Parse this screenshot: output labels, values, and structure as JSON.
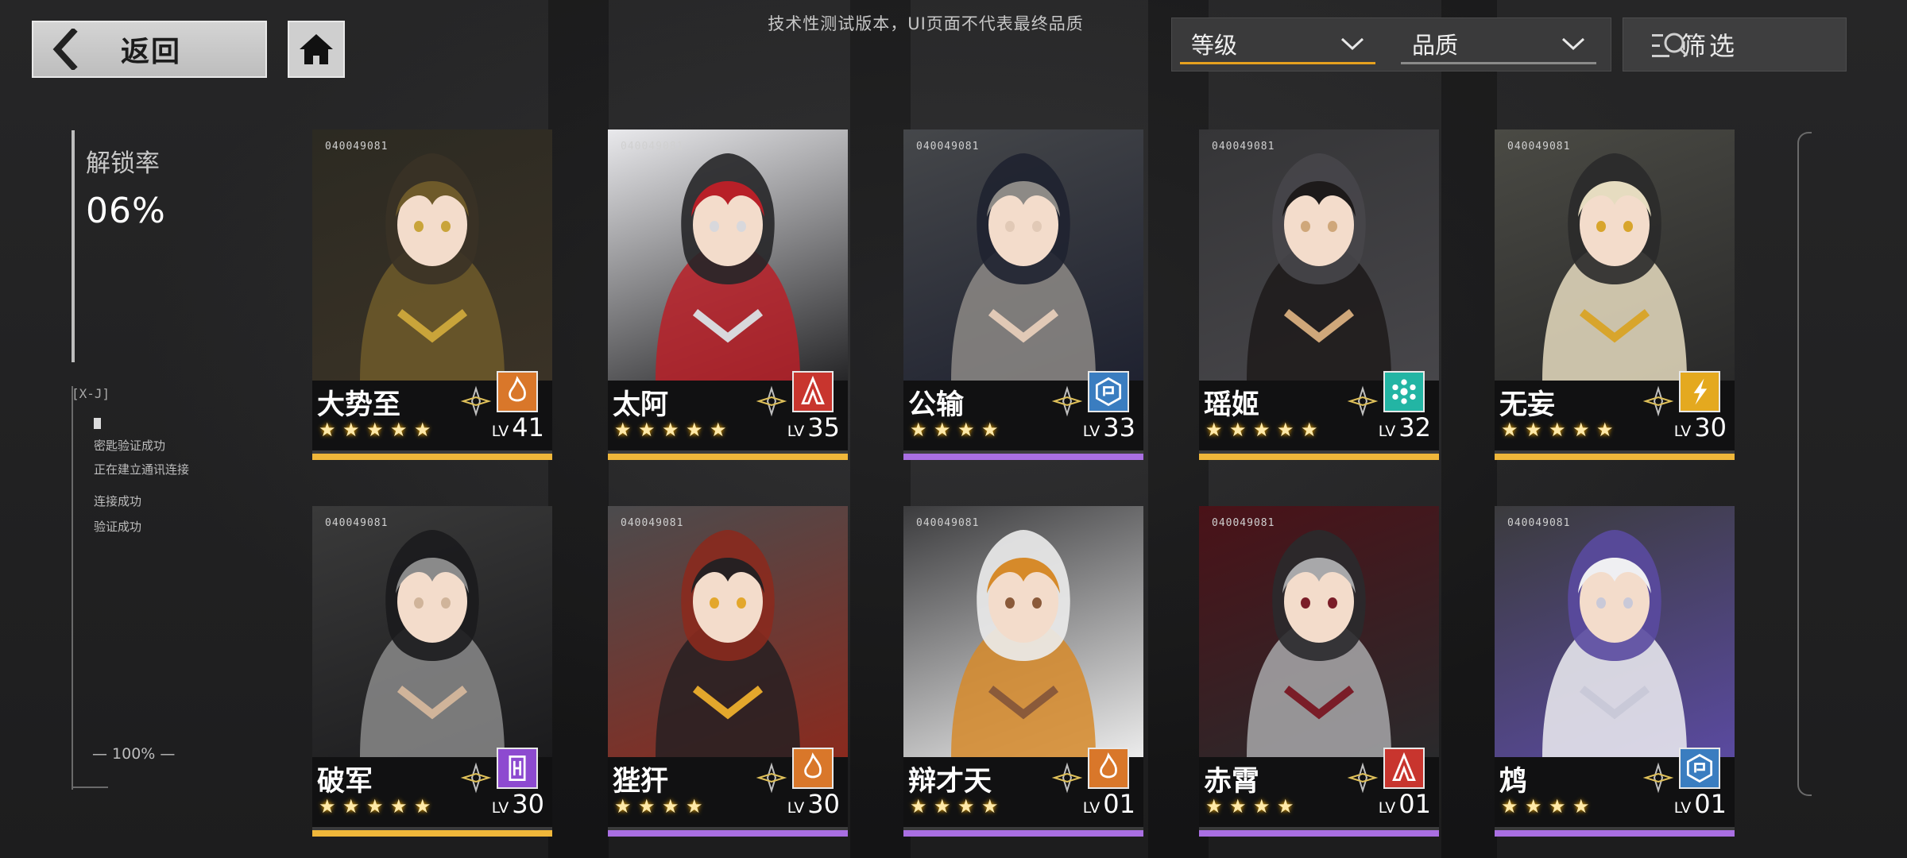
{
  "nav": {
    "back_label": "返回"
  },
  "notice": "技术性测试版本，UI页面不代表最终品质",
  "sort": {
    "primary": "等级",
    "secondary": "品质",
    "filter_label": "筛选"
  },
  "side_panel": {
    "unlock_label": "解锁率",
    "unlock_value": "06%",
    "terminal_tag": "[X-J]",
    "log_lines": [
      "密匙验证成功",
      "正在建立通讯连接",
      "连接成功",
      "验证成功"
    ],
    "progress_label": "100%"
  },
  "colors": {
    "rarity_gold": "#f0b73a",
    "rarity_purple": "#a96fe2",
    "element_fire": "#d9772a",
    "element_red": "#c8352e",
    "element_blue": "#3a7dc0",
    "element_cyan": "#23b5a4",
    "element_yellow": "#e4a91f",
    "element_violet": "#8d4ad0"
  },
  "cards": [
    {
      "name": "大势至",
      "code": "040049081",
      "stars": 5,
      "level": "41",
      "lv_prefix": "LV",
      "element": "fire-element-icon",
      "rarity": "gold"
    },
    {
      "name": "太阿",
      "code": "040049081",
      "stars": 5,
      "level": "35",
      "lv_prefix": "LV",
      "element": "red-element-icon",
      "rarity": "gold"
    },
    {
      "name": "公输",
      "code": "040049081",
      "stars": 4,
      "level": "33",
      "lv_prefix": "LV",
      "element": "blue-element-icon",
      "rarity": "purple"
    },
    {
      "name": "瑶姬",
      "code": "040049081",
      "stars": 5,
      "level": "32",
      "lv_prefix": "LV",
      "element": "cyan-element-icon",
      "rarity": "gold"
    },
    {
      "name": "无妄",
      "code": "040049081",
      "stars": 5,
      "level": "30",
      "lv_prefix": "LV",
      "element": "yellow-element-icon",
      "rarity": "gold"
    },
    {
      "name": "破军",
      "code": "040049081",
      "stars": 5,
      "level": "30",
      "lv_prefix": "LV",
      "element": "violet-element-icon",
      "rarity": "gold"
    },
    {
      "name": "狴犴",
      "code": "040049081",
      "stars": 4,
      "level": "30",
      "lv_prefix": "LV",
      "element": "fire-element-icon",
      "rarity": "purple"
    },
    {
      "name": "辩才天",
      "code": "040049081",
      "stars": 4,
      "level": "01",
      "lv_prefix": "LV",
      "element": "fire-element-icon",
      "rarity": "purple"
    },
    {
      "name": "赤霄",
      "code": "040049081",
      "stars": 4,
      "level": "01",
      "lv_prefix": "LV",
      "element": "red-element-icon",
      "rarity": "purple"
    },
    {
      "name": "鸩",
      "code": "040049081",
      "stars": 4,
      "level": "01",
      "lv_prefix": "LV",
      "element": "blue-element-icon",
      "rarity": "purple"
    }
  ]
}
